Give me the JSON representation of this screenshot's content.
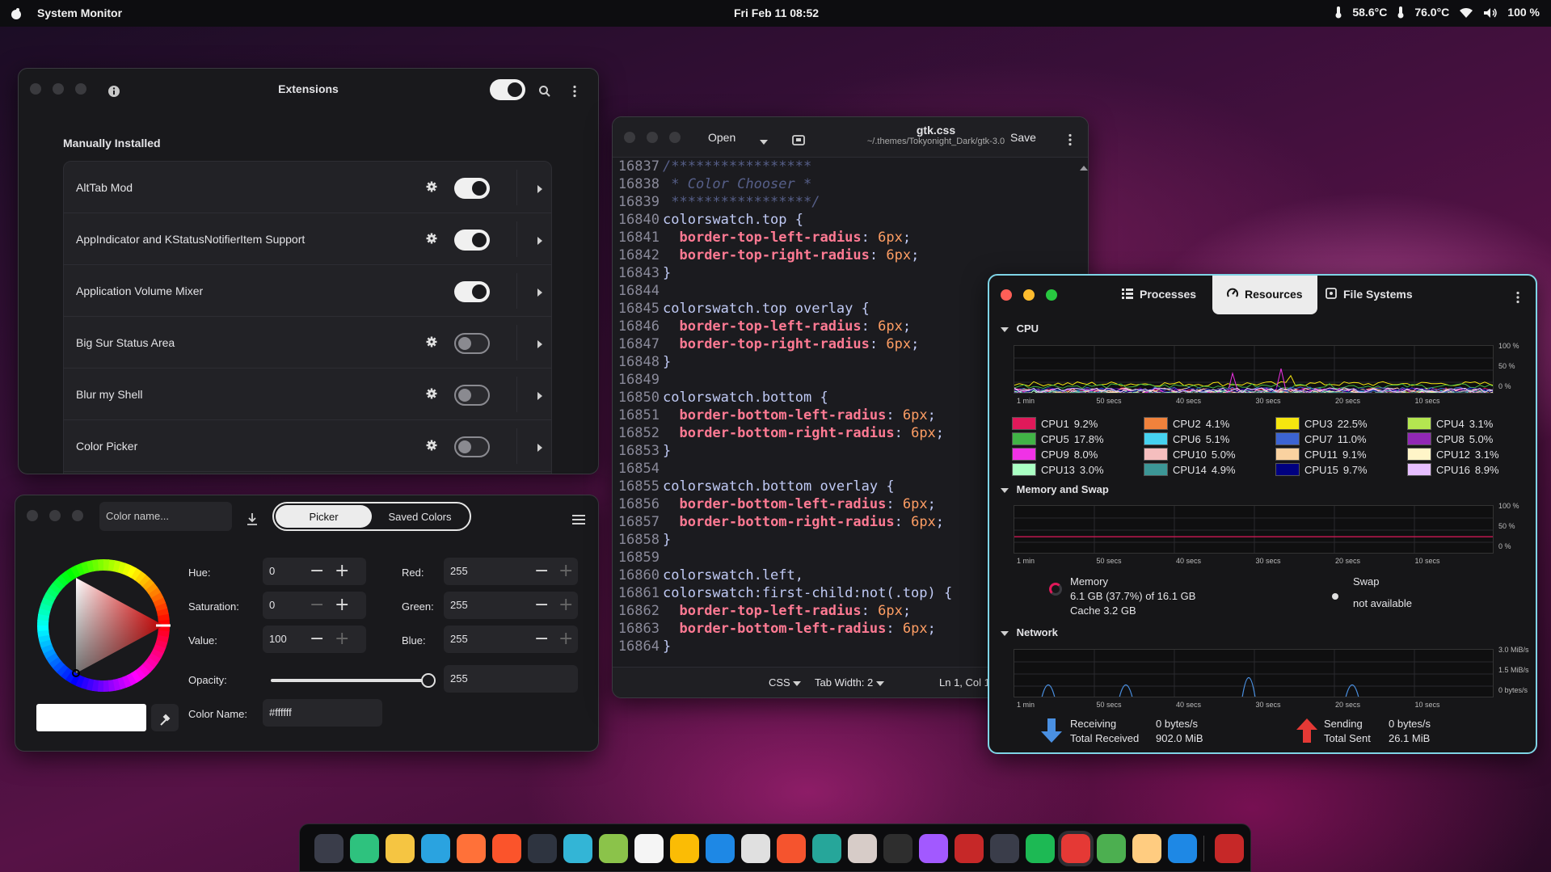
{
  "topbar": {
    "app_name": "System Monitor",
    "clock": "Fri Feb 11  08:52",
    "temp1": "58.6°C",
    "temp2": "76.0°C",
    "battery": "100 %"
  },
  "extensions": {
    "title": "Extensions",
    "section": "Manually Installed",
    "master_enabled": true,
    "items": [
      {
        "name": "AltTab Mod",
        "has_settings": true,
        "enabled": true
      },
      {
        "name": "AppIndicator and KStatusNotifierItem Support",
        "has_settings": true,
        "enabled": true
      },
      {
        "name": "Application Volume Mixer",
        "has_settings": false,
        "enabled": true
      },
      {
        "name": "Big Sur Status Area",
        "has_settings": true,
        "enabled": false
      },
      {
        "name": "Blur my Shell",
        "has_settings": true,
        "enabled": false
      },
      {
        "name": "Color Picker",
        "has_settings": true,
        "enabled": false
      }
    ]
  },
  "picker": {
    "name_placeholder": "Color name...",
    "tab_picker": "Picker",
    "tab_saved": "Saved Colors",
    "hue_label": "Hue:",
    "hue": "0",
    "sat_label": "Saturation:",
    "sat": "0",
    "val_label": "Value:",
    "val": "100",
    "red_label": "Red:",
    "red": "255",
    "green_label": "Green:",
    "green": "255",
    "blue_label": "Blue:",
    "blue": "255",
    "opacity_label": "Opacity:",
    "opacity": "255",
    "opacity_level": 1.0,
    "colorname_label": "Color Name:",
    "colorname": "#ffffff",
    "swatch_color": "#ffffff"
  },
  "editor": {
    "open_label": "Open",
    "file_name": "gtk.css",
    "file_path": "~/.themes/Tokyonight_Dark/gtk-3.0",
    "save_label": "Save",
    "language": "CSS",
    "tab_width": "Tab Width: 2",
    "cursor": "Ln 1, Col 1",
    "lines": [
      {
        "n": "16837",
        "parts": [
          [
            "c-comment",
            "/*****************"
          ]
        ]
      },
      {
        "n": "16838",
        "parts": [
          [
            "c-comment",
            " * Color Chooser *"
          ]
        ]
      },
      {
        "n": "16839",
        "parts": [
          [
            "c-comment",
            " *****************/"
          ]
        ]
      },
      {
        "n": "16840",
        "parts": [
          [
            "c-sel",
            "colorswatch.top {"
          ]
        ]
      },
      {
        "n": "16841",
        "parts": [
          [
            "c-sel",
            "  "
          ],
          [
            "c-prop",
            "border-top-left-radius"
          ],
          [
            "c-sel",
            ": "
          ],
          [
            "c-num",
            "6px"
          ],
          [
            "c-sel",
            ";"
          ]
        ]
      },
      {
        "n": "16842",
        "parts": [
          [
            "c-sel",
            "  "
          ],
          [
            "c-prop",
            "border-top-right-radius"
          ],
          [
            "c-sel",
            ": "
          ],
          [
            "c-num",
            "6px"
          ],
          [
            "c-sel",
            ";"
          ]
        ]
      },
      {
        "n": "16843",
        "parts": [
          [
            "c-sel",
            "}"
          ]
        ]
      },
      {
        "n": "16844",
        "parts": []
      },
      {
        "n": "16845",
        "parts": [
          [
            "c-sel",
            "colorswatch.top overlay {"
          ]
        ]
      },
      {
        "n": "16846",
        "parts": [
          [
            "c-sel",
            "  "
          ],
          [
            "c-prop",
            "border-top-left-radius"
          ],
          [
            "c-sel",
            ": "
          ],
          [
            "c-num",
            "6px"
          ],
          [
            "c-sel",
            ";"
          ]
        ]
      },
      {
        "n": "16847",
        "parts": [
          [
            "c-sel",
            "  "
          ],
          [
            "c-prop",
            "border-top-right-radius"
          ],
          [
            "c-sel",
            ": "
          ],
          [
            "c-num",
            "6px"
          ],
          [
            "c-sel",
            ";"
          ]
        ]
      },
      {
        "n": "16848",
        "parts": [
          [
            "c-sel",
            "}"
          ]
        ]
      },
      {
        "n": "16849",
        "parts": []
      },
      {
        "n": "16850",
        "parts": [
          [
            "c-sel",
            "colorswatch.bottom {"
          ]
        ]
      },
      {
        "n": "16851",
        "parts": [
          [
            "c-sel",
            "  "
          ],
          [
            "c-prop",
            "border-bottom-left-radius"
          ],
          [
            "c-sel",
            ": "
          ],
          [
            "c-num",
            "6px"
          ],
          [
            "c-sel",
            ";"
          ]
        ]
      },
      {
        "n": "16852",
        "parts": [
          [
            "c-sel",
            "  "
          ],
          [
            "c-prop",
            "border-bottom-right-radius"
          ],
          [
            "c-sel",
            ": "
          ],
          [
            "c-num",
            "6px"
          ],
          [
            "c-sel",
            ";"
          ]
        ]
      },
      {
        "n": "16853",
        "parts": [
          [
            "c-sel",
            "}"
          ]
        ]
      },
      {
        "n": "16854",
        "parts": []
      },
      {
        "n": "16855",
        "parts": [
          [
            "c-sel",
            "colorswatch.bottom overlay {"
          ]
        ]
      },
      {
        "n": "16856",
        "parts": [
          [
            "c-sel",
            "  "
          ],
          [
            "c-prop",
            "border-bottom-left-radius"
          ],
          [
            "c-sel",
            ": "
          ],
          [
            "c-num",
            "6px"
          ],
          [
            "c-sel",
            ";"
          ]
        ]
      },
      {
        "n": "16857",
        "parts": [
          [
            "c-sel",
            "  "
          ],
          [
            "c-prop",
            "border-bottom-right-radius"
          ],
          [
            "c-sel",
            ": "
          ],
          [
            "c-num",
            "6px"
          ],
          [
            "c-sel",
            ";"
          ]
        ]
      },
      {
        "n": "16858",
        "parts": [
          [
            "c-sel",
            "}"
          ]
        ]
      },
      {
        "n": "16859",
        "parts": []
      },
      {
        "n": "16860",
        "parts": [
          [
            "c-sel",
            "colorswatch.left,"
          ]
        ]
      },
      {
        "n": "16861",
        "parts": [
          [
            "c-sel",
            "colorswatch:first-child:not(.top) {"
          ]
        ]
      },
      {
        "n": "16862",
        "parts": [
          [
            "c-sel",
            "  "
          ],
          [
            "c-prop",
            "border-top-left-radius"
          ],
          [
            "c-sel",
            ": "
          ],
          [
            "c-num",
            "6px"
          ],
          [
            "c-sel",
            ";"
          ]
        ]
      },
      {
        "n": "16863",
        "parts": [
          [
            "c-sel",
            "  "
          ],
          [
            "c-prop",
            "border-bottom-left-radius"
          ],
          [
            "c-sel",
            ": "
          ],
          [
            "c-num",
            "6px"
          ],
          [
            "c-sel",
            ";"
          ]
        ]
      },
      {
        "n": "16864",
        "parts": [
          [
            "c-sel",
            "}"
          ]
        ]
      }
    ]
  },
  "sysmon": {
    "tabs": [
      "Processes",
      "Resources",
      "File Systems"
    ],
    "active_tab": "Resources",
    "cpu_title": "CPU",
    "mem_title": "Memory and Swap",
    "net_title": "Network",
    "x_ticks": [
      "1 min",
      "50 secs",
      "40 secs",
      "30 secs",
      "20 secs",
      "10 secs"
    ],
    "cpu_y_ticks": [
      "100 %",
      "50 %",
      "0 %"
    ],
    "mem_y_ticks": [
      "100 %",
      "50 %",
      "0 %"
    ],
    "net_y_ticks": [
      "3.0 MiB/s",
      "1.5 MiB/s",
      "0 bytes/s"
    ],
    "cpus": [
      {
        "name": "CPU1",
        "value": "9.2%",
        "color": "#e0195a"
      },
      {
        "name": "CPU2",
        "value": "4.1%",
        "color": "#f0823c"
      },
      {
        "name": "CPU3",
        "value": "22.5%",
        "color": "#f5e60f"
      },
      {
        "name": "CPU4",
        "value": "3.1%",
        "color": "#b4e650"
      },
      {
        "name": "CPU5",
        "value": "17.8%",
        "color": "#41b446"
      },
      {
        "name": "CPU6",
        "value": "5.1%",
        "color": "#46d2f0"
      },
      {
        "name": "CPU7",
        "value": "11.0%",
        "color": "#3c64d2"
      },
      {
        "name": "CPU8",
        "value": "5.0%",
        "color": "#9128b4"
      },
      {
        "name": "CPU9",
        "value": "8.0%",
        "color": "#f032e6"
      },
      {
        "name": "CPU10",
        "value": "5.0%",
        "color": "#f5bebe"
      },
      {
        "name": "CPU11",
        "value": "9.1%",
        "color": "#fad2a0"
      },
      {
        "name": "CPU12",
        "value": "3.1%",
        "color": "#fff5c8"
      },
      {
        "name": "CPU13",
        "value": "3.0%",
        "color": "#aaffc3"
      },
      {
        "name": "CPU14",
        "value": "4.9%",
        "color": "#3c9696"
      },
      {
        "name": "CPU15",
        "value": "9.7%",
        "color": "#000080"
      },
      {
        "name": "CPU16",
        "value": "8.9%",
        "color": "#e6beff"
      }
    ],
    "memory": {
      "title": "Memory",
      "used": "6.1 GB (37.7%) of 16.1 GB",
      "cache": "Cache 3.2 GB",
      "fraction": 0.377
    },
    "swap": {
      "title": "Swap",
      "status": "not available"
    },
    "network": {
      "recv_label": "Receiving",
      "recv_rate": "0 bytes/s",
      "total_recv_label": "Total Received",
      "total_recv": "902.0 MiB",
      "send_label": "Sending",
      "send_rate": "0 bytes/s",
      "total_sent_label": "Total Sent",
      "total_sent": "26.1 MiB"
    }
  },
  "dock": {
    "apps": [
      {
        "name": "app-1",
        "color": "#3a3d4a"
      },
      {
        "name": "app-2",
        "color": "#2ec27e"
      },
      {
        "name": "app-3",
        "color": "#f5c542"
      },
      {
        "name": "telegram",
        "color": "#2aa3e0"
      },
      {
        "name": "firefox",
        "color": "#ff7139"
      },
      {
        "name": "brave",
        "color": "#fb542b"
      },
      {
        "name": "terminal",
        "color": "#2e3440"
      },
      {
        "name": "files",
        "color": "#33b5d6"
      },
      {
        "name": "app-9",
        "color": "#8bc34a"
      },
      {
        "name": "notes",
        "color": "#f5f5f5"
      },
      {
        "name": "chrome",
        "color": "#fbbc05"
      },
      {
        "name": "app-12",
        "color": "#1e88e5"
      },
      {
        "name": "app-13",
        "color": "#e0e0e0"
      },
      {
        "name": "app-14",
        "color": "#f5542e"
      },
      {
        "name": "app-15",
        "color": "#26a69a"
      },
      {
        "name": "app-16",
        "color": "#d7ccc8"
      },
      {
        "name": "app-17",
        "color": "#2e2e2e"
      },
      {
        "name": "figma",
        "color": "#a259ff"
      },
      {
        "name": "app-19",
        "color": "#c62828"
      },
      {
        "name": "app-20",
        "color": "#3a3d4a"
      },
      {
        "name": "spotify",
        "color": "#1db954"
      },
      {
        "name": "system-monitor",
        "color": "#e53935"
      },
      {
        "name": "extensions",
        "color": "#4caf50"
      },
      {
        "name": "app-24",
        "color": "#ffcc80"
      },
      {
        "name": "settings",
        "color": "#1e88e5"
      },
      {
        "name": "trash",
        "color": "#c62828"
      }
    ]
  }
}
